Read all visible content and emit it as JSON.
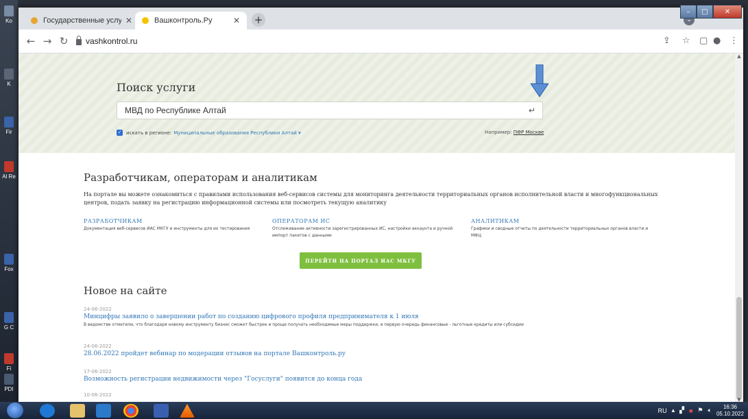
{
  "desktop": {
    "icons": [
      "Ko",
      "K",
      "Fir",
      "Al Re",
      "Fox",
      "G C",
      "Fi",
      "PDI"
    ]
  },
  "browser": {
    "tabs": [
      {
        "title": "Государственные услуги",
        "active": false,
        "color": "#e8a531"
      },
      {
        "title": "Вашконтроль.Ру",
        "active": true,
        "color": "#f5c400"
      }
    ],
    "url": "vashkontrol.ru"
  },
  "search": {
    "title": "Поиск услуги",
    "value": "МВД по Республике Алтай",
    "region_label": "искать в регионе:",
    "region_value": "Муниципальные образования Республики Алтай",
    "example_label": "Например:",
    "example_value": "ПФР Москве"
  },
  "developers": {
    "title": "Разработчикам, операторам и аналитикам",
    "description": "На портале вы можете ознакомиться с правилами использования веб-сервисов системы для мониторинга деятельности территориальных органов исполнительной власти и многофункциональных центров, подать заявку на регистрацию информационной системы или посмотреть текущую аналитику",
    "columns": [
      {
        "heading": "РАЗРАБОТЧИКАМ",
        "text": "Документация веб-сервисов ИАС МКГУ и инструменты для их тестирования"
      },
      {
        "heading": "ОПЕРАТОРАМ ИС",
        "text": "Отслеживание активности зарегистрированных ИС, настройки аккаунта и ручной импорт пакетов с данными"
      },
      {
        "heading": "АНАЛИТИКАМ",
        "text": "Графики и сводные отчеты по деятельности территориальных органов власти и МФЦ"
      }
    ],
    "button_label": "ПЕРЕЙТИ НА ПОРТАЛ ИАС МКГУ"
  },
  "news": {
    "title": "Новое на сайте",
    "items": [
      {
        "date": "24-06-2022",
        "headline": "Минцифры заявило о завершении работ по созданию цифрового профиля предпринимателя к 1 июля",
        "text": "В ведомстве отметили, что благодаря новому инструменту бизнес сможет быстрее и проще получать необходимые меры поддержки, в первую очередь финансовые - льготные кредиты или субсидии"
      },
      {
        "date": "24-06-2022",
        "headline": "28.06.2022 пройдет вебинар по модерации отзывов на портале Вашконтроль.ру",
        "text": ""
      },
      {
        "date": "17-06-2022",
        "headline": "Возможность регистрации недвижимости через \"Госуслуги\" появится до конца года",
        "text": ""
      },
      {
        "date": "10-06-2022",
        "headline": "",
        "text": ""
      }
    ]
  },
  "taskbar": {
    "lang": "RU",
    "time": "16:36",
    "date": "05.10.2022"
  }
}
